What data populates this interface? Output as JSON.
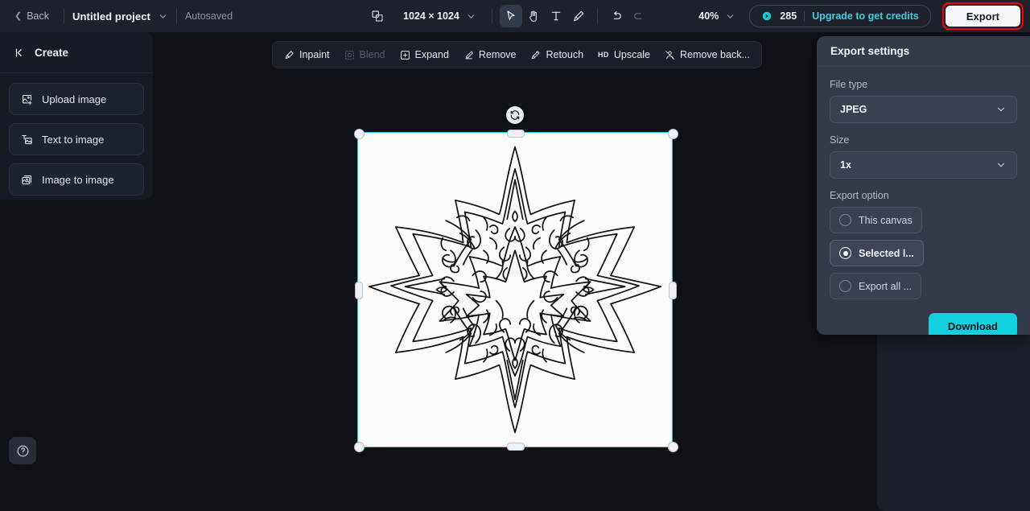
{
  "topbar": {
    "back_label": "Back",
    "project_name": "Untitled project",
    "autosave_label": "Autosaved",
    "canvas_size": "1024 × 1024",
    "zoom_level": "40%",
    "credits_count": "285",
    "upgrade_label": "Upgrade to get credits",
    "export_label": "Export",
    "tools": [
      {
        "name": "frame-icon",
        "label": "Frame"
      },
      {
        "name": "select-tool",
        "label": "Select"
      },
      {
        "name": "hand-tool",
        "label": "Hand"
      },
      {
        "name": "text-tool",
        "label": "Text"
      },
      {
        "name": "brush-tool",
        "label": "Brush"
      },
      {
        "name": "undo-button",
        "label": "Undo"
      },
      {
        "name": "redo-button",
        "label": "Redo"
      }
    ]
  },
  "sidebar": {
    "title": "Create",
    "items": [
      {
        "label": "Upload image",
        "icon": "upload-image-icon"
      },
      {
        "label": "Text to image",
        "icon": "text-to-image-icon"
      },
      {
        "label": "Image to image",
        "icon": "image-to-image-icon"
      }
    ]
  },
  "canvas_toolbar": {
    "items": [
      {
        "label": "Inpaint",
        "icon": "inpaint-icon",
        "disabled": false
      },
      {
        "label": "Blend",
        "icon": "blend-icon",
        "disabled": true
      },
      {
        "label": "Expand",
        "icon": "expand-icon",
        "disabled": false
      },
      {
        "label": "Remove",
        "icon": "remove-icon",
        "disabled": false
      },
      {
        "label": "Retouch",
        "icon": "retouch-icon",
        "disabled": false
      },
      {
        "label": "Upscale",
        "icon": "upscale-icon",
        "disabled": false,
        "badge": "HD"
      },
      {
        "label": "Remove back...",
        "icon": "remove-background-icon",
        "disabled": false
      }
    ]
  },
  "export_panel": {
    "title": "Export settings",
    "file_type_label": "File type",
    "file_type_value": "JPEG",
    "size_label": "Size",
    "size_value": "1x",
    "export_option_label": "Export option",
    "options": [
      {
        "label": "This canvas",
        "selected": false
      },
      {
        "label": "Selected l...",
        "selected": true
      },
      {
        "label": "Export all ...",
        "selected": false
      }
    ],
    "download_label": "Download"
  },
  "canvas": {
    "artwork_alt": "mandala-star-line-art",
    "selected": true
  },
  "help": {
    "label": "Help"
  },
  "colors": {
    "accent": "#12d0e0",
    "selection": "#1ecbd6",
    "topbar_bg": "#1e222b",
    "stage_bg": "#101218",
    "panel_bg": "#333a48",
    "highlight_outline": "#ff0000"
  }
}
